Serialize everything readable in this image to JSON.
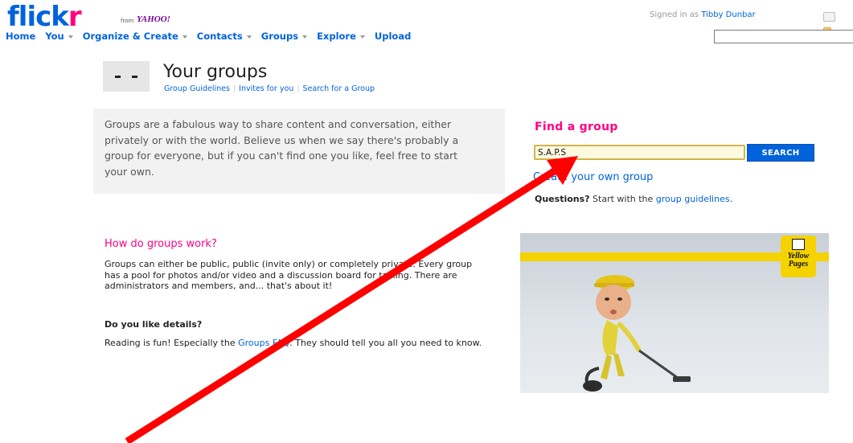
{
  "header": {
    "logo_main": "flick",
    "logo_r": "r",
    "logo_from": "from",
    "logo_yahoo": "YAHOO!",
    "signed_in_prefix": "Signed in as",
    "user_name": "Tibby Dunbar",
    "nav": [
      {
        "label": "Home"
      },
      {
        "label": "You"
      },
      {
        "label": "Organize & Create"
      },
      {
        "label": "Contacts"
      },
      {
        "label": "Groups"
      },
      {
        "label": "Explore"
      },
      {
        "label": "Upload"
      }
    ],
    "search_value": ""
  },
  "page": {
    "title": "Your groups",
    "sublinks": [
      "Group Guidelines",
      "Invites for you",
      "Search for a Group"
    ]
  },
  "intro": {
    "text": "Groups are a fabulous way to share content and conversation, either privately or with the world. Believe us when we say there's probably a group for everyone, but if you can't find one you like, feel free to start your own."
  },
  "find": {
    "title": "Find a group",
    "input_value": "S.A.P.S",
    "button_label": "SEARCH",
    "create_link": "Create your own group",
    "questions_bold": "Questions?",
    "questions_text": " Start with the ",
    "questions_link": "group guidelines",
    "questions_end": "."
  },
  "how": {
    "title": "How do groups work?",
    "body": "Groups can either be public, public (invite only) or completely private. Every group has a pool for photos and/or video and a discussion board for talking. There are administrators and members, and... that's about it!",
    "details_title": "Do you like details?",
    "details_pre": "Reading is fun! Especially the ",
    "details_link": "Groups FAQ",
    "details_post": ". They should tell you all you need to know."
  },
  "ad": {
    "brand_line1": "Yellow",
    "brand_line2": "Pages"
  },
  "colors": {
    "flickr_blue": "#0063dc",
    "flickr_pink": "#ff0084",
    "arrow_red": "#ff0000",
    "yellow_pages": "#f4d300"
  }
}
